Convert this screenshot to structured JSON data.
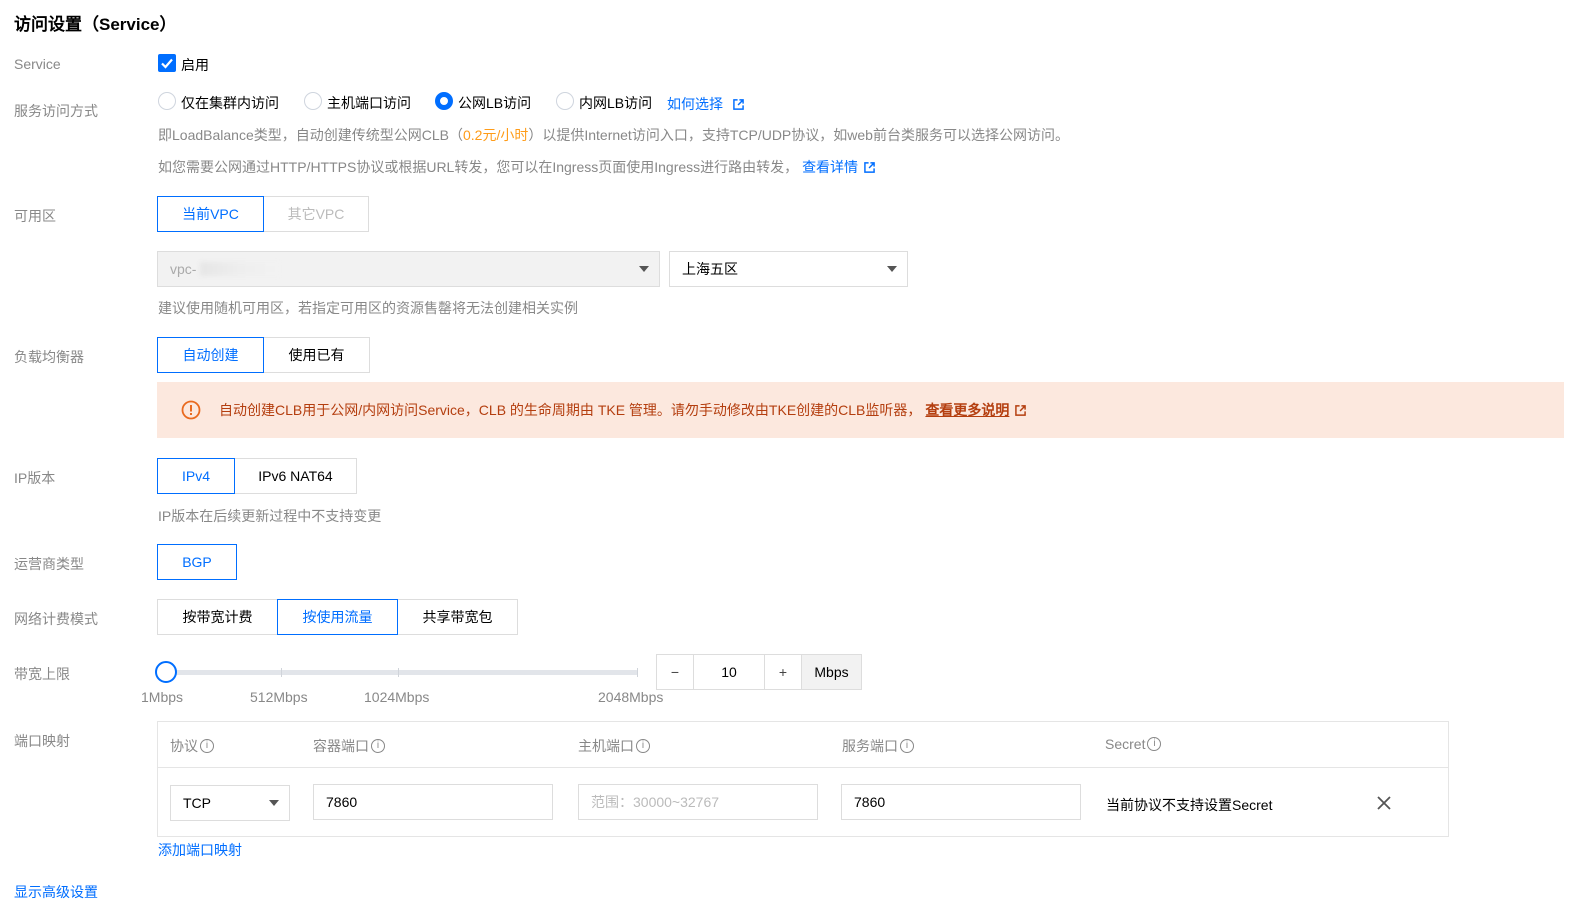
{
  "section_title": "访问设置（Service）",
  "labels": {
    "service": "Service",
    "access_mode": "服务访问方式",
    "zone": "可用区",
    "load_balancer": "负载均衡器",
    "ip_version": "IP版本",
    "isp_type": "运营商类型",
    "billing_mode": "网络计费模式",
    "bandwidth_limit": "带宽上限",
    "port_mapping": "端口映射"
  },
  "service_enable": {
    "label": "启用",
    "checked": true
  },
  "access_mode": {
    "options": [
      "仅在集群内访问",
      "主机端口访问",
      "公网LB访问",
      "内网LB访问"
    ],
    "selected": "公网LB访问",
    "help_link": "如何选择"
  },
  "desc": {
    "line1_a": "即LoadBalance类型，自动创建传统型公网CLB（",
    "line1_price": "0.2元/小时",
    "line1_b": "）以提供Internet访问入口，支持TCP/UDP协议，如web前台类服务可以选择公网访问。",
    "line2": "如您需要公网通过HTTP/HTTPS协议或根据URL转发，您可以在Ingress页面使用Ingress进行路由转发，",
    "line2_link": "查看详情"
  },
  "zone": {
    "tabs": [
      "当前VPC",
      "其它VPC"
    ],
    "vpc_select": "vpc-",
    "region_select": "上海五区",
    "hint": "建议使用随机可用区，若指定可用区的资源售罄将无法创建相关实例"
  },
  "load_balancer": {
    "tabs": [
      "自动创建",
      "使用已有"
    ],
    "alert": "自动创建CLB用于公网/内网访问Service，CLB 的生命周期由 TKE 管理。请勿手动修改由TKE创建的CLB监听器，",
    "alert_link": "查看更多说明"
  },
  "ip_version": {
    "tabs": [
      "IPv4",
      "IPv6 NAT64"
    ],
    "hint": "IP版本在后续更新过程中不支持变更"
  },
  "isp": {
    "tabs": [
      "BGP"
    ]
  },
  "billing": {
    "tabs": [
      "按带宽计费",
      "按使用流量",
      "共享带宽包"
    ],
    "selected": "按使用流量"
  },
  "bandwidth": {
    "ticks": [
      "1Mbps",
      "512Mbps",
      "1024Mbps",
      "2048Mbps"
    ],
    "value": "10",
    "unit": "Mbps",
    "minus": "−",
    "plus": "+"
  },
  "port_table": {
    "headers": [
      "协议",
      "容器端口",
      "主机端口",
      "服务端口",
      "Secret"
    ],
    "row": {
      "protocol": "TCP",
      "container_port": "7860",
      "host_port_placeholder": "范围：30000~32767",
      "service_port": "7860",
      "secret_note": "当前协议不支持设置Secret"
    },
    "add_link": "添加端口映射"
  },
  "advanced_link": "显示高级设置",
  "colors": {
    "primary": "#006eff",
    "warning_bg": "#fce8de",
    "warning_text": "#b43e0f",
    "price": "#ff9c19"
  }
}
